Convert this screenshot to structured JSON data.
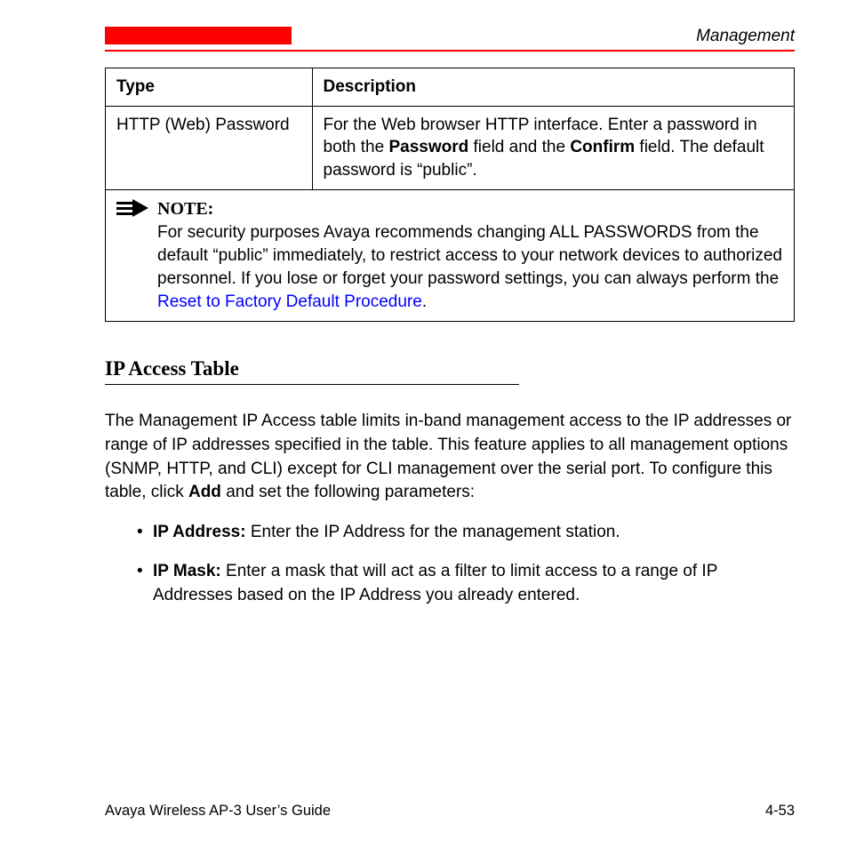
{
  "header": {
    "section": "Management"
  },
  "table": {
    "col1": "Type",
    "col2": "Description",
    "row1_type": "HTTP (Web) Password",
    "row1_desc_a": "For the Web browser HTTP interface. Enter a password in both the ",
    "row1_desc_b": "Password",
    "row1_desc_c": " field and the ",
    "row1_desc_d": "Confirm",
    "row1_desc_e": " field. The default password is “public”.",
    "note_label": "NOTE:",
    "note_text_a": "For security purposes Avaya recommends changing ALL PASSWORDS from the default “public” immediately, to restrict access to your network devices to authorized personnel. If you lose or forget your password settings, you can always perform the ",
    "note_link": "Reset to Factory Default Procedure",
    "note_text_b": "."
  },
  "section": {
    "heading": "IP Access Table",
    "para_a": "The Management IP Access table limits in-band management access to the IP addresses or range of IP addresses specified in the table. This feature applies to all management options (SNMP, HTTP, and CLI) except for CLI management over the serial port. To configure this table, click ",
    "para_b": "Add",
    "para_c": " and set the following parameters:",
    "bullet1_label": "IP Address:",
    "bullet1_text": " Enter the IP Address for the management station.",
    "bullet2_label": "IP Mask:",
    "bullet2_text": " Enter a mask that will act as a filter to limit access to a range of IP Addresses based on the IP Address you already entered."
  },
  "footer": {
    "left": "Avaya Wireless AP-3 User’s Guide",
    "right": "4-53"
  }
}
